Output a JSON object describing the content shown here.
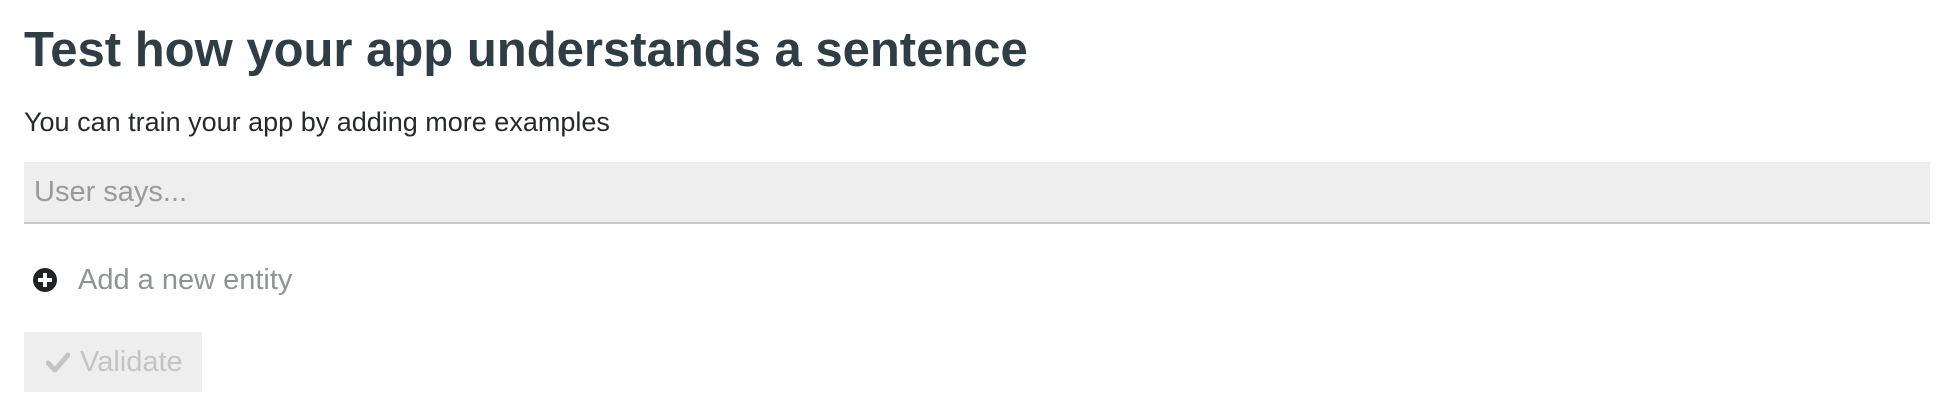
{
  "header": {
    "title": "Test how your app understands a sentence",
    "subtitle": "You can train your app by adding more examples"
  },
  "sentence_input": {
    "value": "",
    "placeholder": "User says..."
  },
  "add_entity": {
    "icon": "plus-circle-icon",
    "label": "Add a new entity"
  },
  "validate": {
    "icon": "check-icon",
    "label": "Validate",
    "enabled": false
  },
  "colors": {
    "title": "#2f3d44",
    "input_bg": "#eeeeee",
    "muted_text": "#8e939a",
    "disabled_text": "#c4c4c4"
  }
}
